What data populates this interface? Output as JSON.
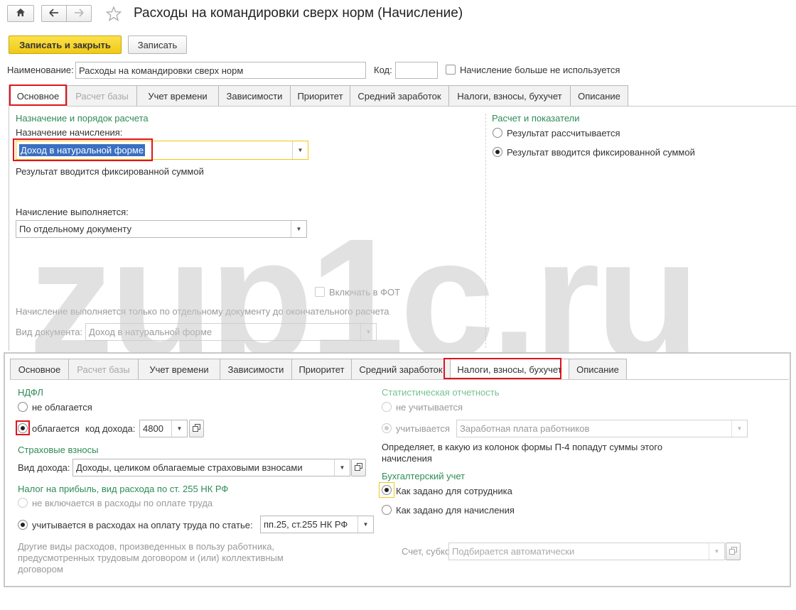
{
  "window": {
    "title": "Расходы на командировки сверх норм (Начисление)"
  },
  "toolbar": {
    "save_close_label": "Записать и закрыть",
    "save_label": "Записать"
  },
  "header": {
    "name_label": "Наименование:",
    "name_value": "Расходы на командировки сверх норм",
    "code_label": "Код:",
    "code_value": "",
    "unused_label": "Начисление больше не используется"
  },
  "tabs": [
    {
      "label": "Основное"
    },
    {
      "label": "Расчет базы"
    },
    {
      "label": "Учет времени"
    },
    {
      "label": "Зависимости"
    },
    {
      "label": "Приоритет"
    },
    {
      "label": "Средний заработок"
    },
    {
      "label": "Налоги, взносы, бухучет"
    },
    {
      "label": "Описание"
    }
  ],
  "main": {
    "purpose_section": "Назначение и порядок расчета",
    "purpose_label": "Назначение начисления:",
    "purpose_value": "Доход в натуральной форме",
    "purpose_hint": "Результат вводится фиксированной суммой",
    "executed_label": "Начисление выполняется:",
    "executed_value": "По отдельному документу",
    "include_fot_label": "Включать в ФОТ",
    "only_doc_text": "Начисление выполняется только по отдельному документу до окончательного расчета",
    "doc_type_label": "Вид документа:",
    "doc_type_value": "Доход в натуральной форме",
    "calc_section": "Расчет и показатели",
    "calc_opt1": "Результат рассчитывается",
    "calc_opt2": "Результат вводится фиксированной суммой"
  },
  "taxes": {
    "ndfl_section": "НДФЛ",
    "ndfl_opt1": "не облагается",
    "ndfl_opt2": "облагается",
    "income_code_label": "код дохода:",
    "income_code_value": "4800",
    "insurance_section": "Страховые взносы",
    "income_type_label": "Вид дохода:",
    "income_type_value": "Доходы, целиком облагаемые страховыми взносами",
    "profit_tax_section": "Налог на прибыль, вид расхода по ст. 255 НК РФ",
    "profit_opt1": "не включается в расходы по оплате труда",
    "profit_opt2": "учитывается в расходах на оплату труда по статье:",
    "article_value": "пп.25, ст.255 НК РФ",
    "other_expenses_text": "Другие виды расходов, произведенных в пользу работника, предусмотренных трудовым договором и (или) коллективным договором",
    "stat_section": "Статистическая отчетность",
    "stat_opt1": "не учитывается",
    "stat_opt2": "учитывается",
    "stat_value": "Заработная плата работников",
    "stat_hint": "Определяет, в какую из колонок формы П-4 попадут суммы этого начисления",
    "acc_section": "Бухгалтерский учет",
    "acc_opt1": "Как задано для сотрудника",
    "acc_opt2": "Как задано для начисления",
    "account_label": "Счет, субконто:",
    "account_placeholder": "Подбирается автоматически"
  },
  "watermark": "zup1c.ru",
  "colors": {
    "accent_yellow": "#f5d327",
    "section_green": "#2e8b57",
    "highlight_red": "#e0141e",
    "selection_blue": "#3a6fc1"
  }
}
